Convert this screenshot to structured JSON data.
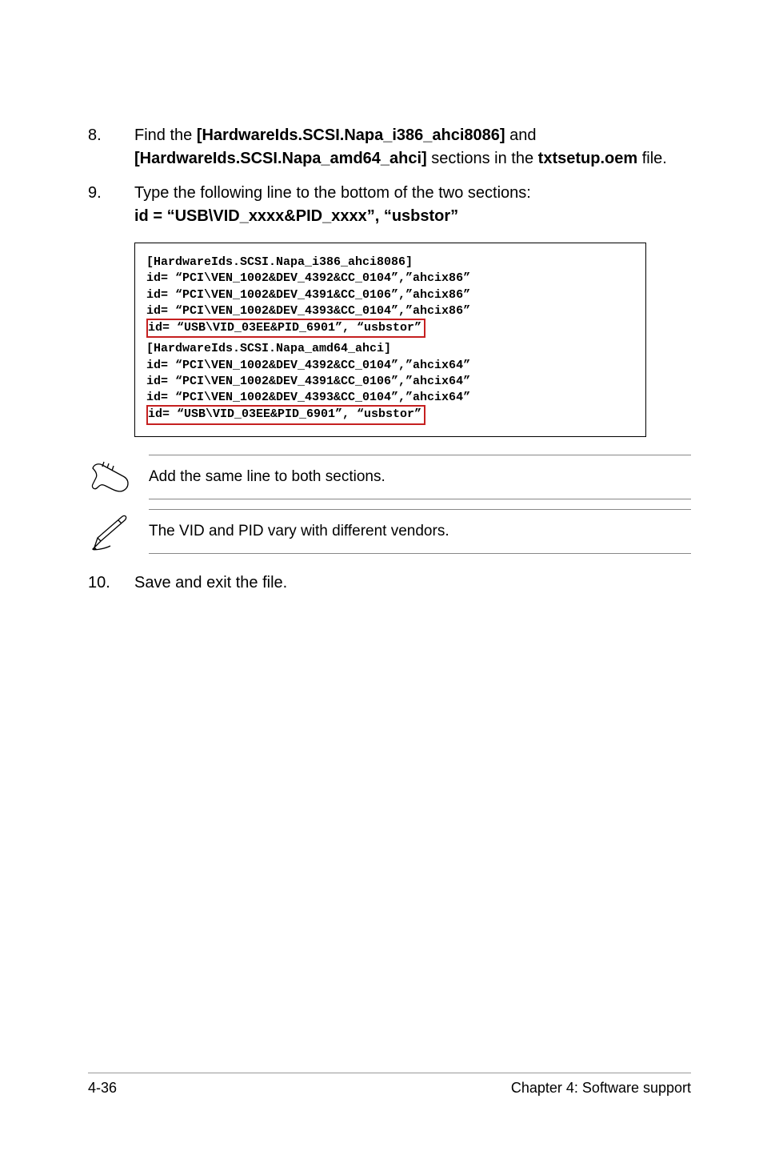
{
  "step8": {
    "num": "8.",
    "t1": "Find the ",
    "b1": "[HardwareIds.SCSI.Napa_i386_ahci8086]",
    "t2": " and ",
    "b2": "[HardwareIds.SCSI.Napa_amd64_ahci]",
    "t3": " sections in the ",
    "b3": "txtsetup.oem",
    "t4": " file."
  },
  "step9": {
    "num": "9.",
    "t1": "Type the following line to the bottom of the two sections:",
    "b1": "id = “USB\\VID_xxxx&PID_xxxx”, “usbstor”"
  },
  "code": {
    "l1": "[HardwareIds.SCSI.Napa_i386_ahci8086]",
    "l2": "id= “PCI\\VEN_1002&DEV_4392&CC_0104”,”ahcix86”",
    "l3": "id= “PCI\\VEN_1002&DEV_4391&CC_0106”,”ahcix86”",
    "l4": "id= “PCI\\VEN_1002&DEV_4393&CC_0104”,”ahcix86”",
    "h1": "id= “USB\\VID_03EE&PID_6901”, “usbstor”",
    "l5": "[HardwareIds.SCSI.Napa_amd64_ahci]",
    "l6": "id= “PCI\\VEN_1002&DEV_4392&CC_0104”,”ahcix64”",
    "l7": "id= “PCI\\VEN_1002&DEV_4391&CC_0106”,”ahcix64”",
    "l8": "id= “PCI\\VEN_1002&DEV_4393&CC_0104”,”ahcix64”",
    "h2": "id= “USB\\VID_03EE&PID_6901”, “usbstor”"
  },
  "note1": "Add the same line to both sections.",
  "note2": "The VID and PID vary with different vendors.",
  "step10": {
    "num": "10.",
    "t1": "Save and exit the file."
  },
  "footer": {
    "left": "4-36",
    "right": "Chapter 4: Software support"
  }
}
